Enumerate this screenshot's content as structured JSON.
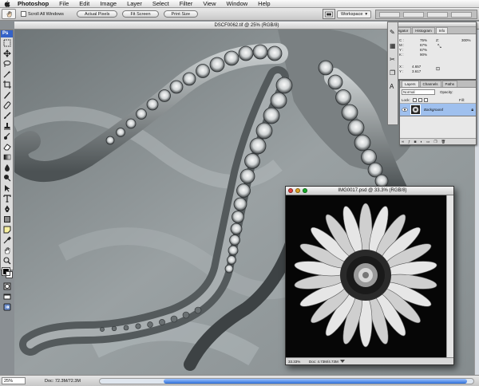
{
  "menubar": {
    "app": "Photoshop",
    "items": [
      "File",
      "Edit",
      "Image",
      "Layer",
      "Select",
      "Filter",
      "View",
      "Window",
      "Help"
    ]
  },
  "options": {
    "scroll_all_windows": "Scroll All Windows",
    "actual_pixels": "Actual Pixels",
    "fit_screen": "Fit Screen",
    "print_size": "Print Size",
    "workspace": "Workspace"
  },
  "document": {
    "title": "DSCF0062.tif @ 25% (RGB/8)",
    "zoom": "25%",
    "doc_info": "Doc: 72.3M/72.3M"
  },
  "toolbox": {
    "header": "Ps"
  },
  "info_palette": {
    "tabs": [
      "Navigator",
      "Histogram",
      "Info"
    ],
    "c_label": "C :",
    "c_value": "75%",
    "m_label": "M :",
    "m_value": "67%",
    "y_label": "Y :",
    "y_value": "67%",
    "k_label": "K :",
    "k_value": "90%",
    "bit_depth": "8-bit",
    "r_label": "Z:",
    "r_value": "300%",
    "x_label": "X :",
    "x_value": "4.657",
    "ylabel": "Y :",
    "ycoord_value": "3.617"
  },
  "layers_palette": {
    "tabs": [
      "Layers",
      "Channels",
      "Paths"
    ],
    "blend_mode": "Normal",
    "opacity_label": "Opacity:",
    "lock_label": "Lock:",
    "fill_label": "Fill:",
    "layer_name": "Background"
  },
  "flower_window": {
    "title": "IMG0017.psd @ 33.3% (RGB/8)",
    "zoom": "33.33%",
    "doc_info": "Doc: 4.73M/4.73M"
  },
  "colors": {
    "selection_blue": "#9fc0ee",
    "scroll_blue": "#2e6fd8"
  }
}
